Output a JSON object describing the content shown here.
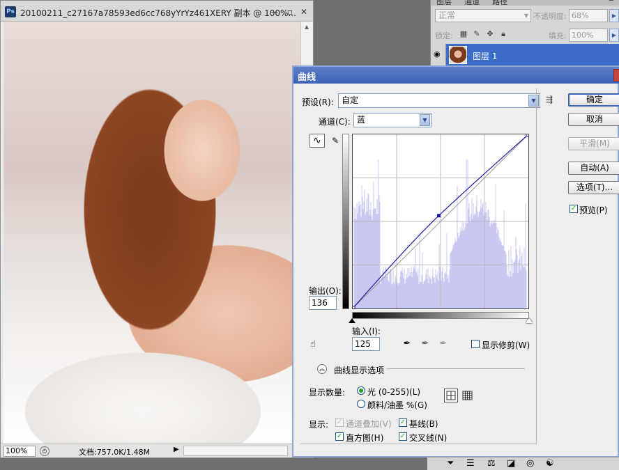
{
  "document": {
    "title": "20100211_c27167a78593ed6cc768yYrYz461XERY 副本 @ 100%...",
    "app_icon": "Ps",
    "zoom": "100%",
    "doc_info": "文档:757.0K/1.48M"
  },
  "layers_panel": {
    "tabs": [
      "图层",
      "通道",
      "路径"
    ],
    "blend_mode": "正常",
    "opacity_label": "不透明度:",
    "opacity_value": "68%",
    "lock_label": "锁定:",
    "fill_label": "填充:",
    "fill_value": "100%",
    "layer_name": "图层 1"
  },
  "curves": {
    "title": "曲线",
    "preset_label": "预设(R):",
    "preset_value": "自定",
    "channel_label": "通道(C):",
    "channel_value": "蓝",
    "buttons": {
      "ok": "确定",
      "cancel": "取消",
      "smooth": "平滑(M)",
      "auto": "自动(A)",
      "options": "选项(T)..."
    },
    "preview_label": "预览(P)",
    "preview_checked": true,
    "output_label": "输出(O):",
    "output_value": "136",
    "input_label": "输入(I):",
    "input_value": "125",
    "show_clipping_label": "显示修剪(W)",
    "show_clipping_checked": false,
    "display_options_title": "曲线显示选项",
    "show_amount_label": "显示数量:",
    "light_option": "光 (0-255)(L)",
    "light_selected": true,
    "pigment_option": "颜料/油墨 %(G)",
    "show_label": "显示:",
    "channel_overlay_label": "通道叠加(V)",
    "channel_overlay_checked": true,
    "baseline_label": "基线(B)",
    "baseline_checked": true,
    "histogram_label": "直方图(H)",
    "histogram_checked": true,
    "intersection_label": "交叉线(N)",
    "intersection_checked": true,
    "curve_point": {
      "input": 125,
      "output": 136
    },
    "curve_color": "#1a1aa8",
    "histogram_color": "#c8c8f0"
  }
}
